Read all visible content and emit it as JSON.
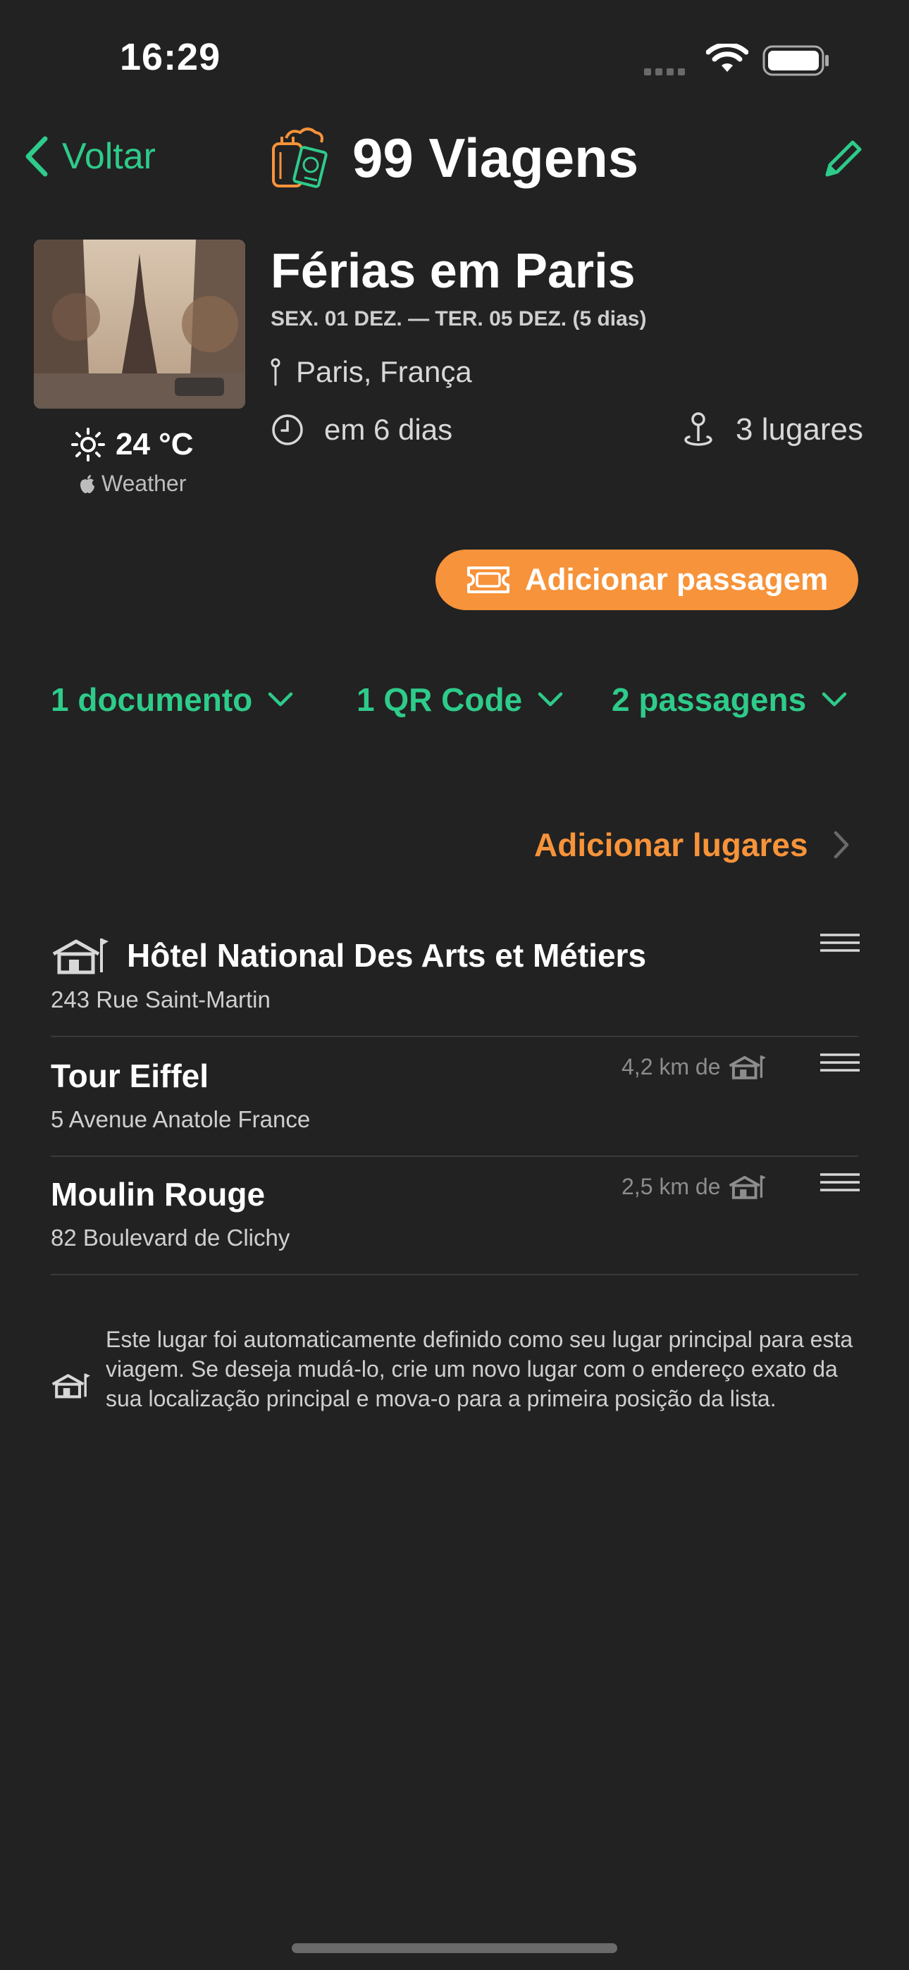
{
  "status_bar": {
    "time": "16:29"
  },
  "nav": {
    "back_label": "Voltar",
    "title": "99 Viagens"
  },
  "trip": {
    "title": "Férias em Paris",
    "dates": "SEX. 01 DEZ. — TER. 05 DEZ.  (5 dias)",
    "location": "Paris, França",
    "countdown": "em 6 dias",
    "places_count": "3 lugares",
    "weather_temp": "24 °C",
    "weather_source": "Weather"
  },
  "actions": {
    "add_ticket": "Adicionar passagem",
    "add_places": "Adicionar lugares"
  },
  "collapsibles": [
    {
      "label": "1 documento"
    },
    {
      "label": "1 QR Code"
    },
    {
      "label": "2 passagens"
    }
  ],
  "places": [
    {
      "name": "Hôtel National Des Arts et Métiers",
      "address": "243 Rue Saint-Martin",
      "distance": ""
    },
    {
      "name": "Tour Eiffel",
      "address": "5 Avenue Anatole France",
      "distance": "4,2 km de"
    },
    {
      "name": "Moulin Rouge",
      "address": "82 Boulevard de Clichy",
      "distance": "2,5 km de"
    }
  ],
  "note": "Este lugar foi automaticamente definido como seu lugar principal para esta viagem. Se deseja mudá-lo, crie um novo lugar com o endereço exato da sua localização principal e mova-o para a primeira posição da lista.",
  "colors": {
    "accent_green": "#2ecb8a",
    "accent_orange": "#f7933a",
    "background": "#222222"
  }
}
